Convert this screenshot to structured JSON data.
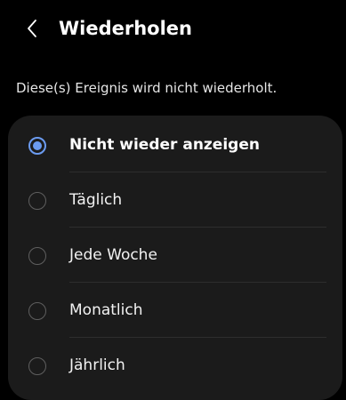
{
  "header": {
    "back_icon": "chevron-left-icon",
    "title": "Wiederholen"
  },
  "description": "Diese(s) Ereignis wird nicht wiederholt.",
  "options": [
    {
      "label": "Nicht wieder anzeigen",
      "selected": true
    },
    {
      "label": "Täglich",
      "selected": false
    },
    {
      "label": "Jede Woche",
      "selected": false
    },
    {
      "label": "Monatlich",
      "selected": false
    },
    {
      "label": "Jährlich",
      "selected": false
    }
  ],
  "colors": {
    "background": "#000000",
    "card": "#1b1b1b",
    "accent": "#6b9bf0",
    "radio_unselected": "#5f5f5f"
  }
}
